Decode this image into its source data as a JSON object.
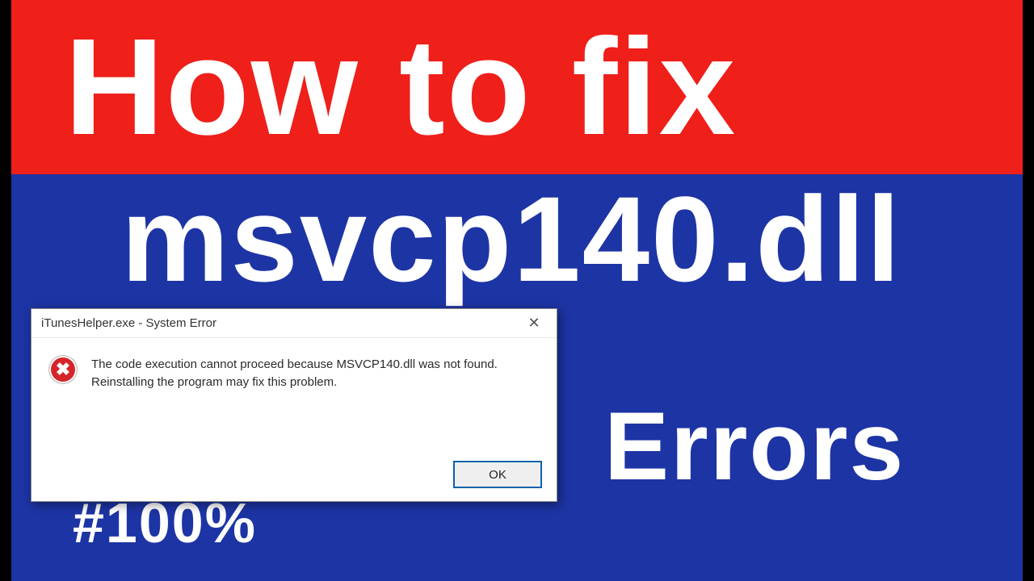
{
  "banner": {
    "line1": "How to fix",
    "line2": "msvcp140.dll",
    "line3": "Errors",
    "tag": "#100%"
  },
  "dialog": {
    "title": "iTunesHelper.exe - System Error",
    "message": "The code execution cannot proceed because MSVCP140.dll was not found. Reinstalling the program may fix this problem.",
    "ok_label": "OK",
    "close_glyph": "✕",
    "error_glyph": "✖"
  },
  "colors": {
    "red": "#ef1f1a",
    "blue": "#1d34a4",
    "error_red": "#d5252a",
    "ok_border": "#0a64ad"
  }
}
